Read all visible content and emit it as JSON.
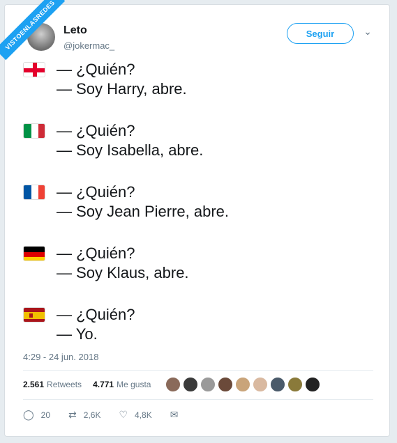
{
  "watermark": "VISTOENLASREDES",
  "user": {
    "name": "Leto",
    "handle": "@jokermac_"
  },
  "follow_label": "Seguir",
  "caret_icon": "chevron-down-icon",
  "dialogs": [
    {
      "flag": "england",
      "q": "— ¿Quién?",
      "a": "— Soy Harry, abre."
    },
    {
      "flag": "italy",
      "q": "— ¿Quién?",
      "a": "— Soy Isabella, abre."
    },
    {
      "flag": "france",
      "q": "— ¿Quién?",
      "a": "— Soy Jean Pierre, abre."
    },
    {
      "flag": "germany",
      "q": "— ¿Quién?",
      "a": "— Soy Klaus, abre."
    },
    {
      "flag": "spain",
      "q": "— ¿Quién?",
      "a": "— Yo."
    }
  ],
  "timestamp": "4:29 - 24 jun. 2018",
  "stats": {
    "retweets_count": "2.561",
    "retweets_label": "Retweets",
    "likes_count": "4.771",
    "likes_label": "Me gusta"
  },
  "actions": {
    "replies": "20",
    "retweets": "2,6K",
    "likes": "4,8K"
  },
  "colors": {
    "accent": "#1da1f2",
    "text": "#14171a",
    "muted": "#657786"
  }
}
